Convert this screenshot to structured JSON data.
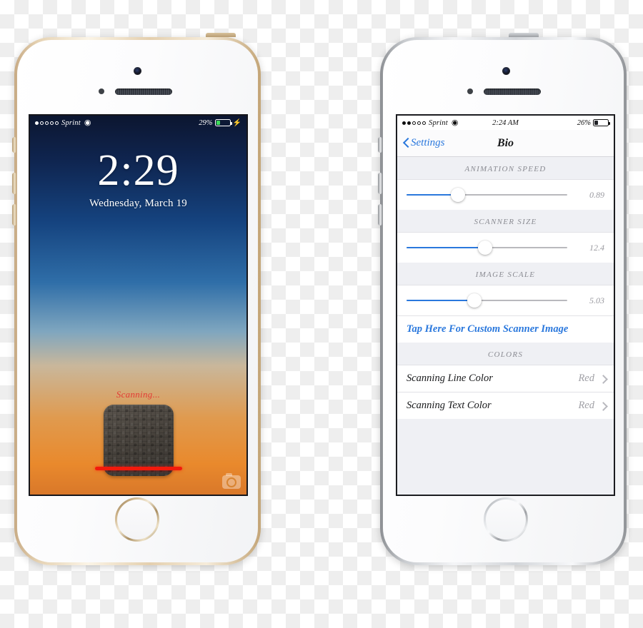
{
  "left_phone": {
    "name": "iphone-gold-lockscreen",
    "status_bar": {
      "signal_dots_filled": 1,
      "signal_dots_total": 5,
      "carrier": "Sprint",
      "wifi_icon": "wifi-icon",
      "battery_percent": "29%",
      "battery_level": 29,
      "battery_color": "#3ddc5b",
      "charging_icon": "⚡"
    },
    "lockscreen": {
      "time": "2:29",
      "date": "Wednesday, March 19",
      "scanning_text": "Scanning...",
      "scanning_text_color": "#e33b34",
      "scanning_line_color": "#f21a0c",
      "camera_icon": "camera-icon"
    }
  },
  "right_phone": {
    "name": "iphone-silver-settings",
    "status_bar": {
      "signal_dots_filled": 2,
      "signal_dots_total": 5,
      "carrier": "Sprint",
      "wifi_icon": "wifi-icon",
      "time": "2:24 AM",
      "battery_percent": "26%",
      "battery_level": 26,
      "battery_color": "#212327"
    },
    "nav": {
      "back_label": "Settings",
      "back_icon": "chevron-left-icon",
      "title": "Bio"
    },
    "sections": [
      {
        "header": "ANIMATION SPEED",
        "slider": {
          "name": "animation-speed-slider",
          "value": "0.89",
          "fill_percent": 32
        }
      },
      {
        "header": "SCANNER SIZE",
        "slider": {
          "name": "scanner-size-slider",
          "value": "12.4",
          "fill_percent": 49
        }
      },
      {
        "header": "IMAGE SCALE",
        "slider": {
          "name": "image-scale-slider",
          "value": "5.03",
          "fill_percent": 42
        },
        "link": "Tap Here For Custom Scanner Image"
      },
      {
        "header": "COLORS",
        "rows": [
          {
            "label": "Scanning Line Color",
            "value": "Red"
          },
          {
            "label": "Scanning Text Color",
            "value": "Red"
          }
        ]
      }
    ],
    "accent_color": "#2a78dd"
  }
}
